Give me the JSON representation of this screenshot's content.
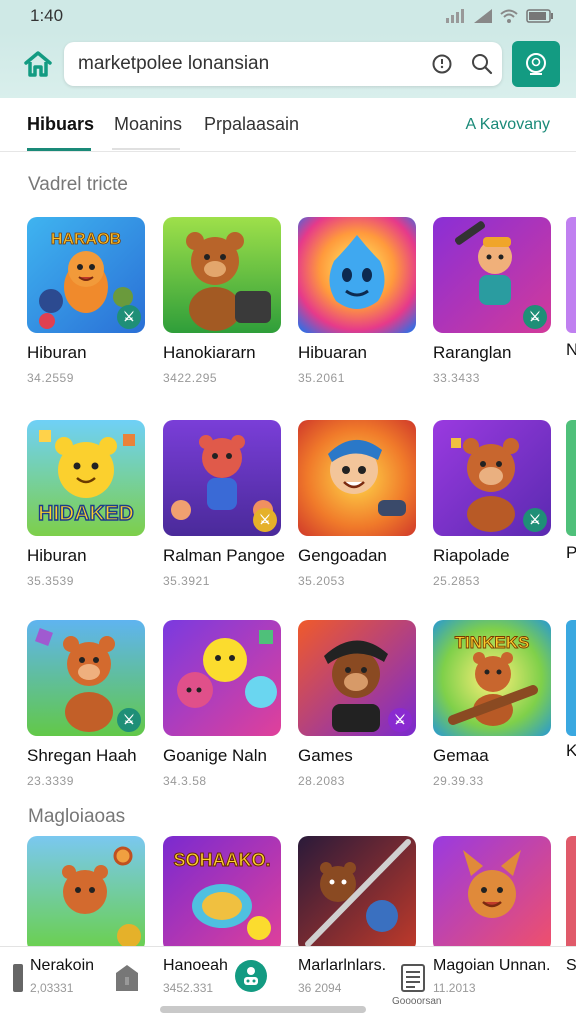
{
  "status": {
    "time": "1:40"
  },
  "search": {
    "query": "marketpolee lonansian"
  },
  "tabs": [
    {
      "label": "Hibuars"
    },
    {
      "label": "Moanins"
    },
    {
      "label": "Prpalaasain"
    }
  ],
  "tab_link": "A Kavovany",
  "sections": [
    {
      "title": "Vadrel tricte"
    },
    {
      "title": "Magloiaoas"
    }
  ],
  "rows": [
    [
      {
        "name": "Hiburan",
        "num": "34.2559",
        "badge": "⚔"
      },
      {
        "name": "Hanokiararn",
        "num": "3422.295",
        "badge": ""
      },
      {
        "name": "Hibuaran",
        "num": "35.2061",
        "badge": ""
      },
      {
        "name": "Raranglan",
        "num": "33.3433",
        "badge": "⚔"
      }
    ],
    [
      {
        "name": "Hiburan",
        "num": "35.3539",
        "badge": ""
      },
      {
        "name": "Ralman Pangoe",
        "num": "35.3921",
        "badge": "⚔"
      },
      {
        "name": "Gengoadan",
        "num": "35.2053",
        "badge": ""
      },
      {
        "name": "Riapolade",
        "num": "25.2853",
        "badge": "⚔"
      }
    ],
    [
      {
        "name": "Shregan Haah",
        "num": "23.3339",
        "badge": "⚔"
      },
      {
        "name": "Goanige Naln",
        "num": "34.3.58",
        "badge": ""
      },
      {
        "name": "Games",
        "num": "28.2083",
        "badge": "⚔"
      },
      {
        "name": "Gemaa",
        "num": "29.39.33",
        "badge": ""
      }
    ]
  ],
  "row_logo_texts": {
    "r0c0": "HARAOB",
    "r1c0": "HIDAKED",
    "r2c3": "TINKEKS",
    "r3c1": "SOHAAKO."
  },
  "edge_letters": [
    "N",
    "P",
    "K"
  ],
  "bottom_nav": [
    {
      "label": "Nerakoin",
      "num": "2,03331"
    },
    {
      "label": "Hanoeah",
      "num": "3452.331"
    },
    {
      "label": "Marlarlnlars.",
      "num": "36 2094"
    },
    {
      "label": "Magoian Unnan.",
      "num": "11.2013"
    },
    {
      "label": "S",
      "num": ""
    }
  ],
  "tiny_label": "Goooorsan",
  "colors": {
    "accent": "#139b82",
    "header_bg": "#cfe9e6"
  }
}
